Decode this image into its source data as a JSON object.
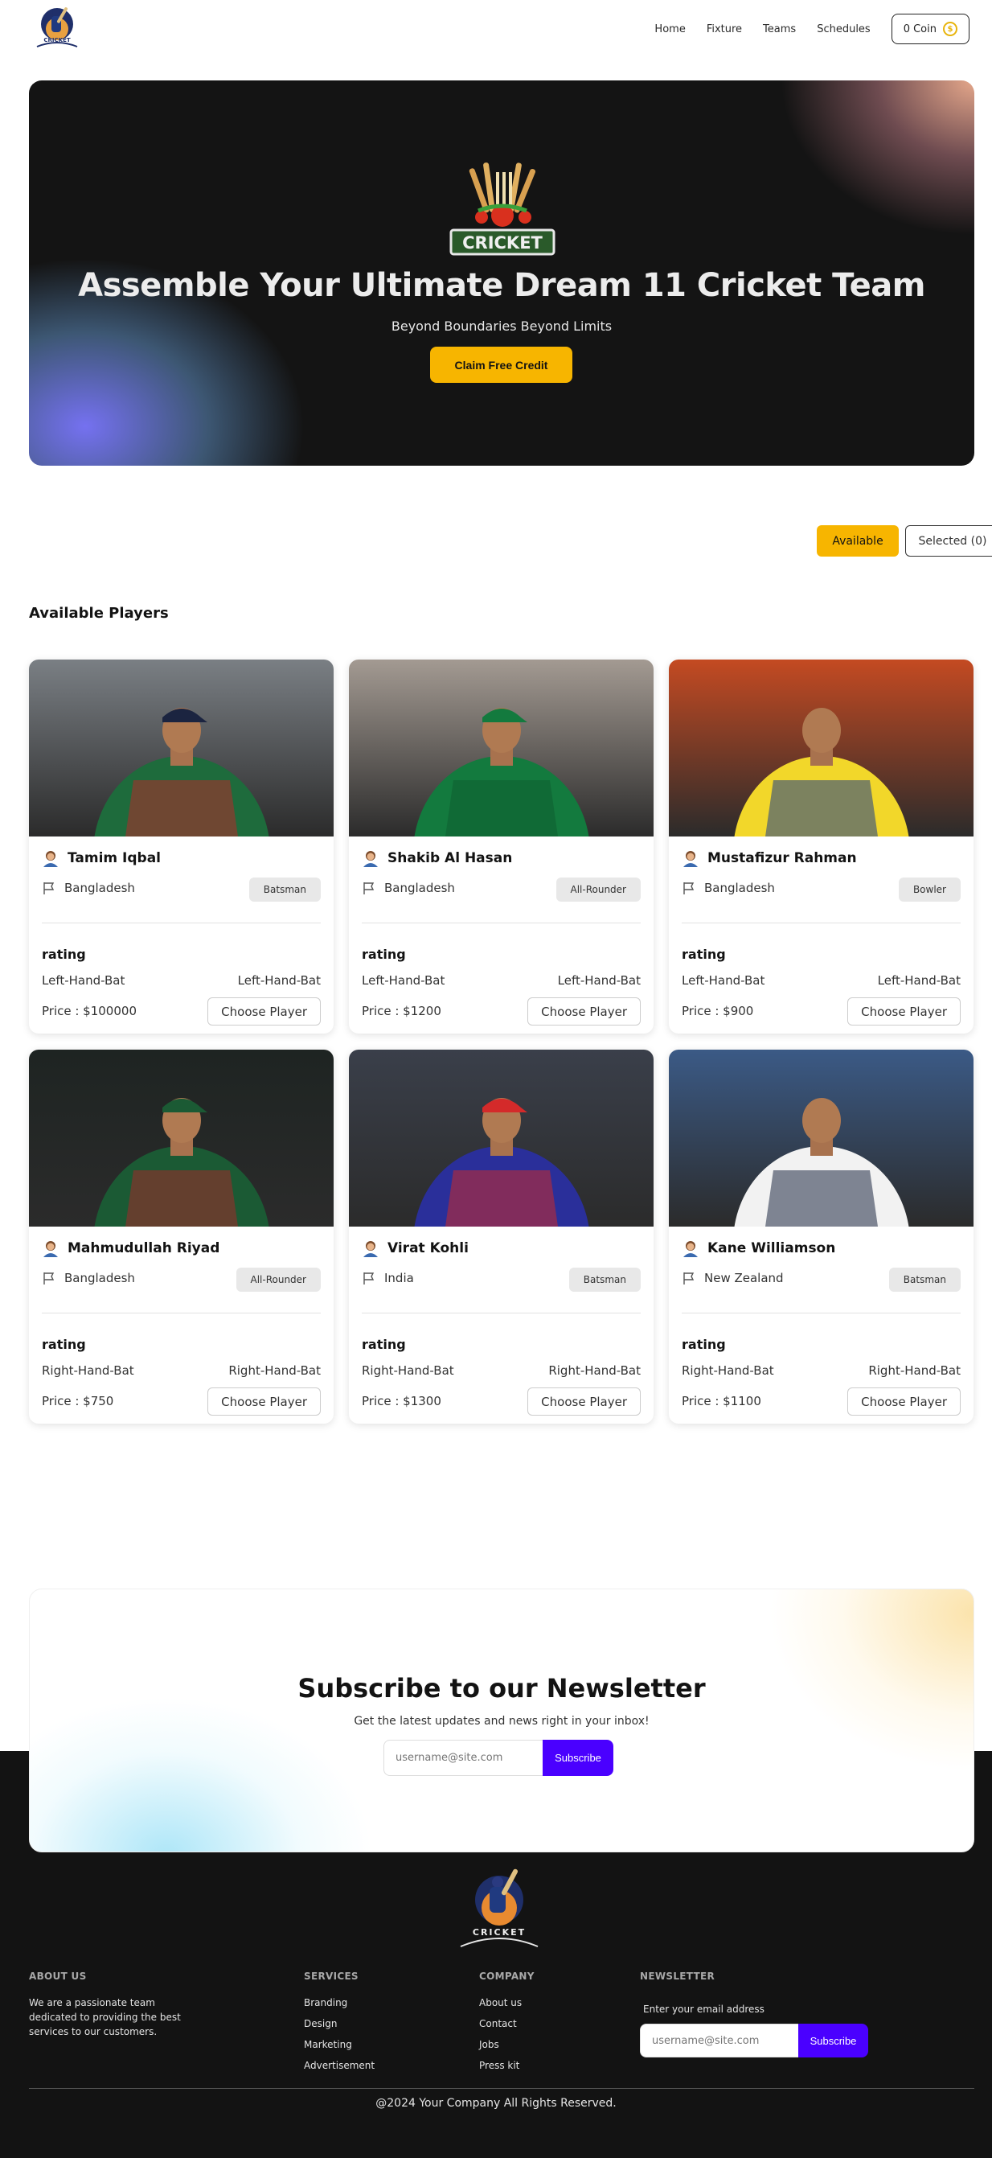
{
  "nav": {
    "logo_text": "CRICKET",
    "links": [
      "Home",
      "Fixture",
      "Teams",
      "Schedules"
    ],
    "coin_label": "0 Coin"
  },
  "hero": {
    "logo_text": "CRICKET",
    "title": "Assemble Your Ultimate Dream 11 Cricket Team",
    "subtitle": "Beyond Boundaries Beyond Limits",
    "cta_label": "Claim Free Credit"
  },
  "toggle": {
    "available_label": "Available",
    "selected_label": "Selected (0)"
  },
  "section_title": "Available Players",
  "players": [
    {
      "name": "Tamim Iqbal",
      "country": "Bangladesh",
      "role": "Batsman",
      "rating_label": "rating",
      "hand_left": "Left-Hand-Bat",
      "hand_right": "Left-Hand-Bat",
      "price": "Price : $100000",
      "button": "Choose Player",
      "jersey": "#1e6b3c",
      "jersey2": "#b22a2a",
      "bg": "#7a7f84",
      "cap": "#1b2440"
    },
    {
      "name": "Shakib Al Hasan",
      "country": "Bangladesh",
      "role": "All-Rounder",
      "rating_label": "rating",
      "hand_left": "Left-Hand-Bat",
      "hand_right": "Left-Hand-Bat",
      "price": "Price : $1200",
      "button": "Choose Player",
      "jersey": "#137a3e",
      "jersey2": "#0f5c2f",
      "bg": "#a39a92",
      "cap": "#137a3e"
    },
    {
      "name": "Mustafizur Rahman",
      "country": "Bangladesh",
      "role": "Bowler",
      "rating_label": "rating",
      "hand_left": "Left-Hand-Bat",
      "hand_right": "Left-Hand-Bat",
      "price": "Price : $900",
      "button": "Choose Player",
      "jersey": "#f2d72a",
      "jersey2": "#1c3d8a",
      "bg": "#c44a22",
      "cap": ""
    },
    {
      "name": "Mahmudullah Riyad",
      "country": "Bangladesh",
      "role": "All-Rounder",
      "rating_label": "rating",
      "hand_left": "Right-Hand-Bat",
      "hand_right": "Right-Hand-Bat",
      "price": "Price : $750",
      "button": "Choose Player",
      "jersey": "#1b5a34",
      "jersey2": "#a02a2a",
      "bg": "#1e2422",
      "cap": "#1b5a34"
    },
    {
      "name": "Virat Kohli",
      "country": "India",
      "role": "Batsman",
      "rating_label": "rating",
      "hand_left": "Right-Hand-Bat",
      "hand_right": "Right-Hand-Bat",
      "price": "Price : $1300",
      "button": "Choose Player",
      "jersey": "#2a2f9a",
      "jersey2": "#c92a2a",
      "bg": "#3a3f4a",
      "cap": "#d42a2a"
    },
    {
      "name": "Kane Williamson",
      "country": "New Zealand",
      "role": "Batsman",
      "rating_label": "rating",
      "hand_left": "Right-Hand-Bat",
      "hand_right": "Right-Hand-Bat",
      "price": "Price : $1100",
      "button": "Choose Player",
      "jersey": "#f2f2f2",
      "jersey2": "#1f2a44",
      "bg": "#3b5a86",
      "cap": ""
    }
  ],
  "newsletter": {
    "title": "Subscribe to our Newsletter",
    "subtitle": "Get the latest updates and news right in your inbox!",
    "placeholder": "username@site.com",
    "button": "Subscribe"
  },
  "footer": {
    "logo_text": "CRICKET",
    "about": {
      "title": "ABOUT US",
      "text": "We are a passionate team dedicated to providing the best services to our customers."
    },
    "services": {
      "title": "SERVICES",
      "links": [
        "Branding",
        "Design",
        "Marketing",
        "Advertisement"
      ]
    },
    "company": {
      "title": "COMPANY",
      "links": [
        "About us",
        "Contact",
        "Jobs",
        "Press kit"
      ]
    },
    "newsletter": {
      "title": "NEWSLETTER",
      "label": "Enter your email address",
      "placeholder": "username@site.com",
      "button": "Subscribe"
    },
    "copyright": "@2024 Your Company All Rights Reserved."
  },
  "colors": {
    "accent": "#f7b500",
    "subscribe": "#4a00ff",
    "dark": "#131313"
  }
}
